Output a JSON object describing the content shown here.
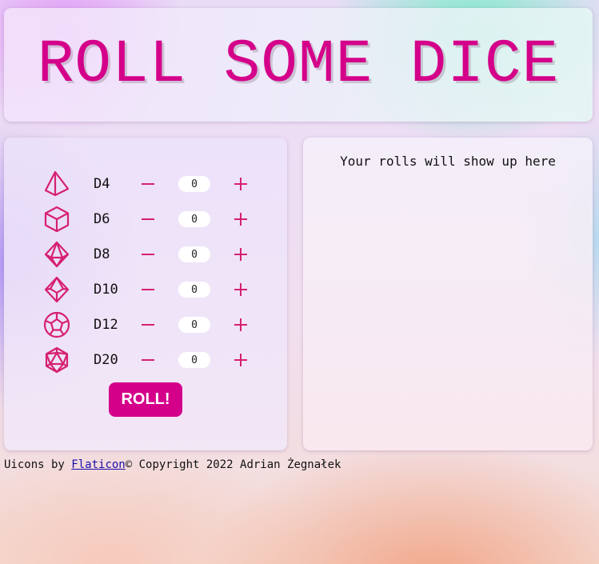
{
  "header": {
    "title": "ROLL SOME DICE"
  },
  "dice": [
    {
      "label": "D4",
      "icon": "d4-icon",
      "count": "0"
    },
    {
      "label": "D6",
      "icon": "d6-icon",
      "count": "0"
    },
    {
      "label": "D8",
      "icon": "d8-icon",
      "count": "0"
    },
    {
      "label": "D10",
      "icon": "d10-icon",
      "count": "0"
    },
    {
      "label": "D12",
      "icon": "d12-icon",
      "count": "0"
    },
    {
      "label": "D20",
      "icon": "d20-icon",
      "count": "0"
    }
  ],
  "roll_button": {
    "label": "ROLL!"
  },
  "results": {
    "placeholder": "Your rolls will show up here"
  },
  "footer": {
    "prefix": "Uicons by ",
    "link_text": "Flaticon",
    "copyright": "© Copyright 2022 Adrian Żegnałek"
  },
  "colors": {
    "accent": "#d4008a",
    "icon_stroke": "#d6206f"
  }
}
